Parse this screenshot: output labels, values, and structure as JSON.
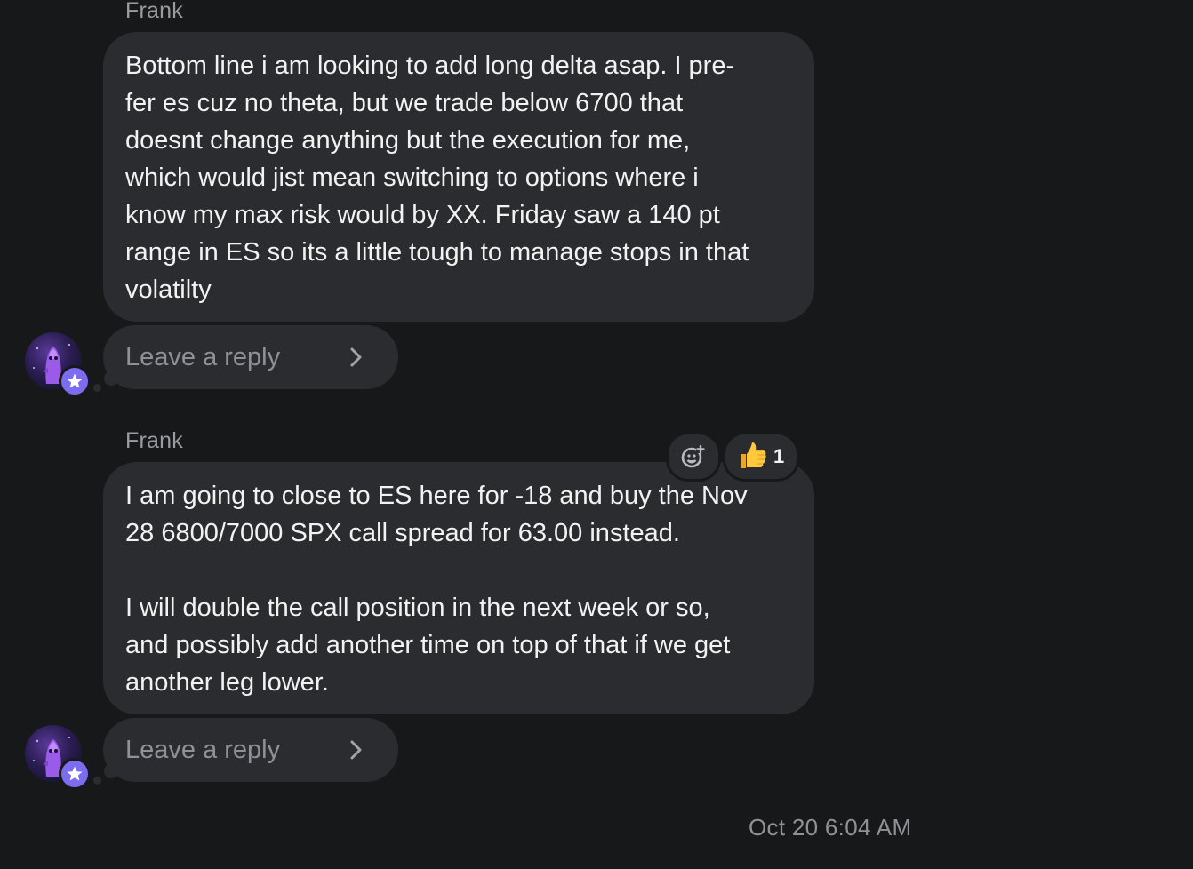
{
  "messages": [
    {
      "sender": "Frank",
      "paragraphs": [
        "Bottom line i am looking to add long delta asap. I pre-\nfer es cuz no theta, but we trade below 6700 that\ndoesnt change anything but the execution for me,\nwhich would jist mean switching to options where i\nknow my max risk would by XX. Friday saw a 140 pt\nrange in ES so its a little tough to manage stops in that\nvolatilty"
      ],
      "reply_placeholder": "Leave a reply"
    },
    {
      "sender": "Frank",
      "paragraphs": [
        "I am going to close to ES here for -18 and buy the Nov\n28 6800/7000 SPX call spread for 63.00 instead.",
        "I will double the call position in the next week or so,\nand possibly add another time on top of that if we get\nanother leg lower."
      ],
      "reply_placeholder": "Leave a reply",
      "reactions": [
        {
          "icon": "thumbs-up-icon",
          "count": "1"
        }
      ]
    }
  ],
  "timestamp": "Oct 20 6:04 AM",
  "colors": {
    "background": "#17181a",
    "bubble": "#2a2c2f",
    "badge": "#7b6cf0"
  }
}
